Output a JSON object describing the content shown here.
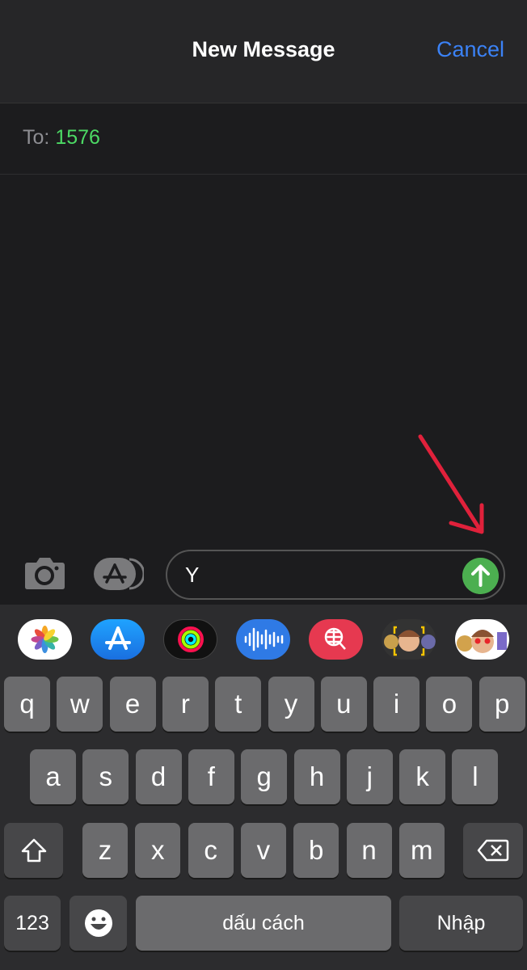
{
  "header": {
    "title": "New Message",
    "cancel_label": "Cancel"
  },
  "recipient": {
    "label": "To:",
    "value": "1576"
  },
  "compose": {
    "text": "Y"
  },
  "keyboard": {
    "row1": [
      "q",
      "w",
      "e",
      "r",
      "t",
      "y",
      "u",
      "i",
      "o",
      "p"
    ],
    "row2": [
      "a",
      "s",
      "d",
      "f",
      "g",
      "h",
      "j",
      "k",
      "l"
    ],
    "row3": [
      "z",
      "x",
      "c",
      "v",
      "b",
      "n",
      "m"
    ],
    "numbers_label": "123",
    "space_label": "dấu cách",
    "return_label": "Nhập"
  },
  "app_strip": [
    "photos-icon",
    "app-store-icon",
    "activity-icon",
    "audio-message-icon",
    "web-search-icon",
    "memoji-camera-icon",
    "memoji-stickers-icon"
  ],
  "colors": {
    "accent": "#3b82f6",
    "recipient": "#4cd964",
    "send": "#4caf50",
    "annotation_arrow": "#e0213b"
  }
}
